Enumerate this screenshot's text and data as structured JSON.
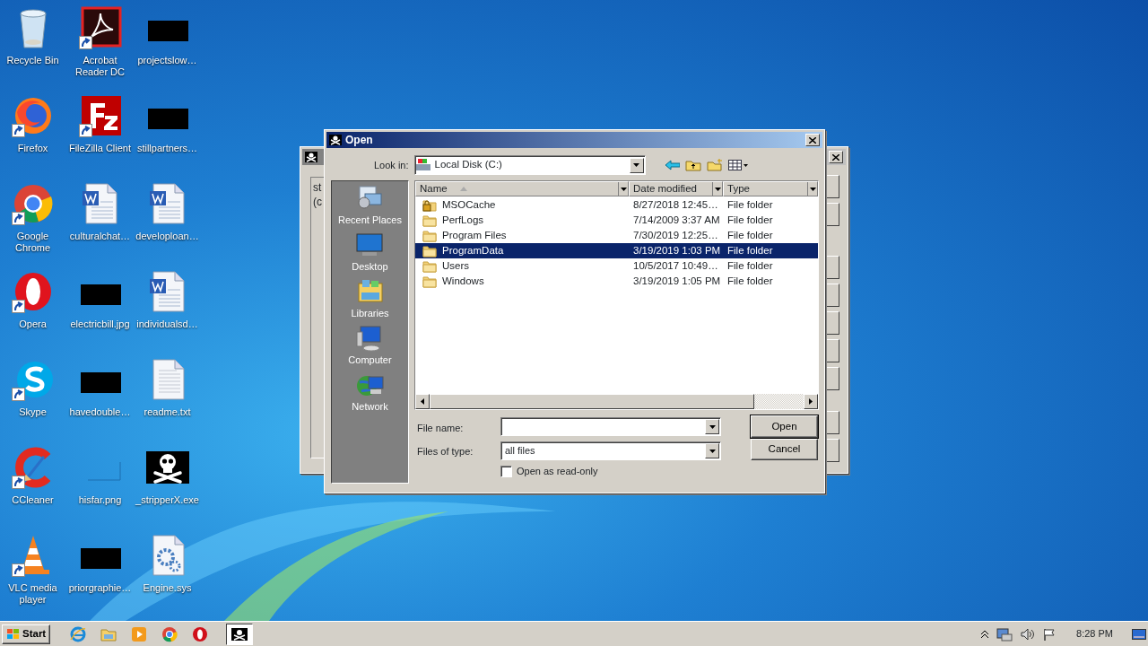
{
  "desktop_icons": [
    {
      "label": "Recycle Bin",
      "kind": "recycle",
      "shortcut": false
    },
    {
      "label": "Acrobat Reader DC",
      "kind": "acrobat",
      "shortcut": true
    },
    {
      "label": "projectslow…",
      "kind": "redacted",
      "shortcut": false
    },
    {
      "label": "Firefox",
      "kind": "firefox",
      "shortcut": true
    },
    {
      "label": "FileZilla Client",
      "kind": "filezilla",
      "shortcut": true
    },
    {
      "label": "stillpartners…",
      "kind": "redacted",
      "shortcut": false
    },
    {
      "label": "Google Chrome",
      "kind": "chrome",
      "shortcut": true
    },
    {
      "label": "culturalchat…",
      "kind": "word",
      "shortcut": false
    },
    {
      "label": "developloan…",
      "kind": "word",
      "shortcut": false
    },
    {
      "label": "Opera",
      "kind": "opera",
      "shortcut": true
    },
    {
      "label": "electricbill.jpg",
      "kind": "redacted",
      "shortcut": false
    },
    {
      "label": "individualsd…",
      "kind": "word",
      "shortcut": false
    },
    {
      "label": "Skype",
      "kind": "skype",
      "shortcut": true
    },
    {
      "label": "havedouble…",
      "kind": "redacted",
      "shortcut": false
    },
    {
      "label": "readme.txt",
      "kind": "text",
      "shortcut": false
    },
    {
      "label": "CCleaner",
      "kind": "ccleaner",
      "shortcut": true
    },
    {
      "label": "hisfar.png",
      "kind": "blank",
      "shortcut": false
    },
    {
      "label": "_stripperX.exe",
      "kind": "skull",
      "shortcut": false
    },
    {
      "label": "VLC media player",
      "kind": "vlc",
      "shortcut": true
    },
    {
      "label": "priorgraphie…",
      "kind": "redacted",
      "shortcut": false
    },
    {
      "label": "Engine.sys",
      "kind": "gear",
      "shortcut": false
    }
  ],
  "background_window": {
    "texts": [
      "st",
      "(c"
    ]
  },
  "dialog": {
    "title": "Open",
    "look_in_label": "Look in:",
    "look_in": "Local Disk (C:)",
    "places": [
      {
        "label": "Recent Places",
        "kind": "recent"
      },
      {
        "label": "Desktop",
        "kind": "desktop"
      },
      {
        "label": "Libraries",
        "kind": "libraries"
      },
      {
        "label": "Computer",
        "kind": "computer"
      },
      {
        "label": "Network",
        "kind": "network"
      }
    ],
    "columns": [
      {
        "label": "Name",
        "sorted": true
      },
      {
        "label": "Date modified",
        "sorted": false
      },
      {
        "label": "Type",
        "sorted": false
      }
    ],
    "rows": [
      {
        "name": "MSOCache",
        "date": "8/27/2018 12:45…",
        "type": "File folder",
        "locked": true,
        "selected": false
      },
      {
        "name": "PerfLogs",
        "date": "7/14/2009 3:37 AM",
        "type": "File folder",
        "locked": false,
        "selected": false
      },
      {
        "name": "Program Files",
        "date": "7/30/2019 12:25…",
        "type": "File folder",
        "locked": false,
        "selected": false
      },
      {
        "name": "ProgramData",
        "date": "3/19/2019 1:03 PM",
        "type": "File folder",
        "locked": false,
        "selected": true
      },
      {
        "name": "Users",
        "date": "10/5/2017 10:49…",
        "type": "File folder",
        "locked": false,
        "selected": false
      },
      {
        "name": "Windows",
        "date": "3/19/2019 1:05 PM",
        "type": "File folder",
        "locked": false,
        "selected": false
      }
    ],
    "file_name_label": "File name:",
    "files_of_type_label": "Files of type:",
    "files_of_type": "all files",
    "read_only": {
      "label": "Open as read-only",
      "checked": false
    },
    "buttons": [
      "Open",
      "Cancel"
    ]
  },
  "taskbar": {
    "start": "Start",
    "items": [
      {
        "kind": "ie",
        "selected": false
      },
      {
        "kind": "explorer",
        "selected": false
      },
      {
        "kind": "media",
        "selected": false
      },
      {
        "kind": "chrome",
        "selected": false
      },
      {
        "kind": "opera",
        "selected": false
      },
      {
        "kind": "skull",
        "selected": true
      }
    ],
    "time": "8:28 PM"
  }
}
